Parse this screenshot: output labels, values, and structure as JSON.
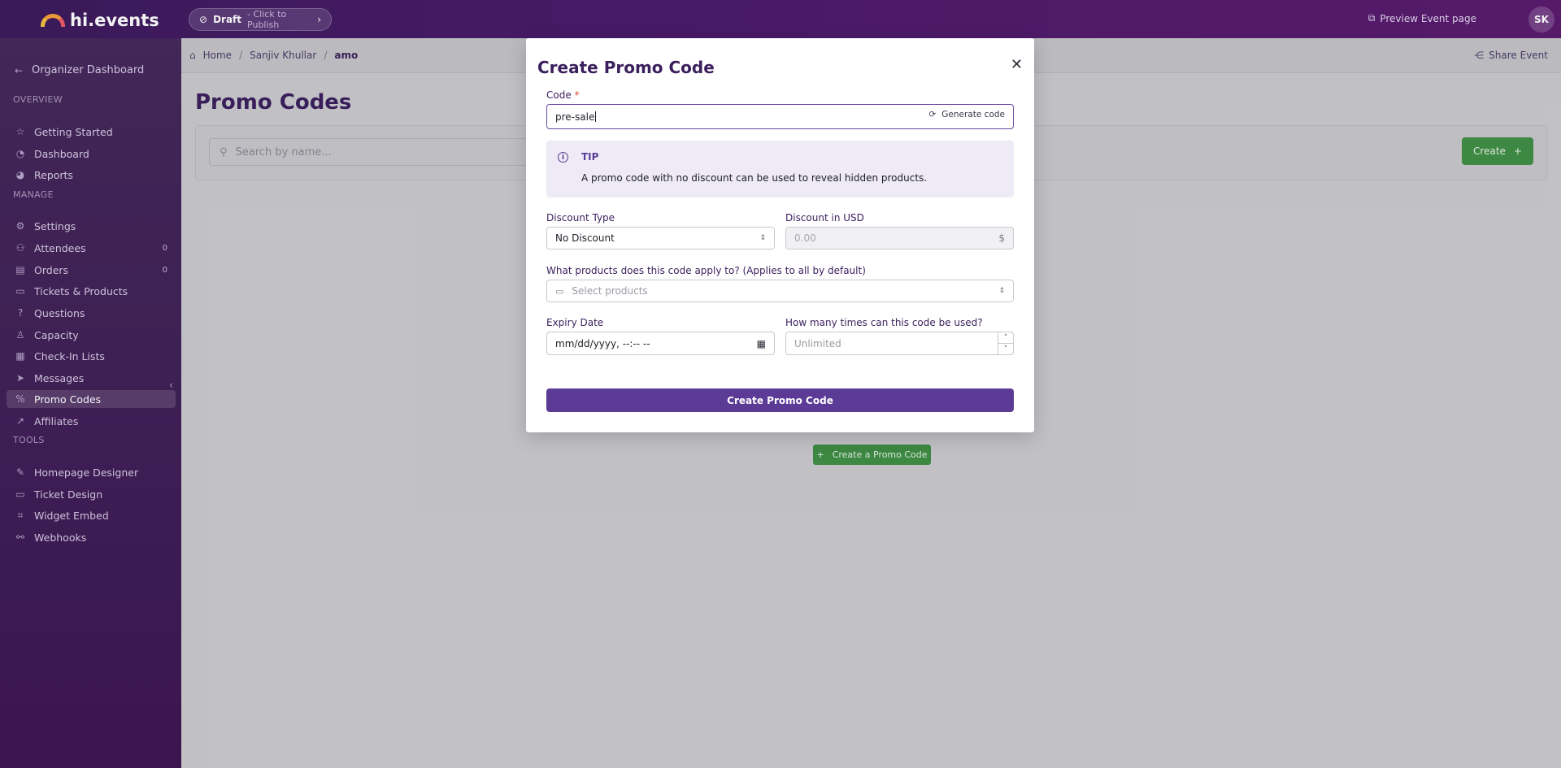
{
  "topbar": {
    "logo_text": "hi.events",
    "draft_label": "Draft",
    "draft_hint": "- Click to Publish",
    "preview_label": "Preview Event page",
    "avatar_initials": "SK"
  },
  "sidebar": {
    "back_label": "Organizer Dashboard",
    "sections": {
      "overview": "OVERVIEW",
      "manage": "MANAGE",
      "tools": "TOOLS"
    },
    "overview_items": [
      {
        "label": "Getting Started",
        "icon": "star-icon"
      },
      {
        "label": "Dashboard",
        "icon": "gauge-icon"
      },
      {
        "label": "Reports",
        "icon": "chart-pie-icon"
      }
    ],
    "manage_items": [
      {
        "label": "Settings",
        "icon": "gear-icon"
      },
      {
        "label": "Attendees",
        "icon": "users-icon",
        "count": "0"
      },
      {
        "label": "Orders",
        "icon": "receipt-icon",
        "count": "0"
      },
      {
        "label": "Tickets & Products",
        "icon": "ticket-icon"
      },
      {
        "label": "Questions",
        "icon": "question-icon"
      },
      {
        "label": "Capacity",
        "icon": "person-icon"
      },
      {
        "label": "Check-In Lists",
        "icon": "qr-icon"
      },
      {
        "label": "Messages",
        "icon": "send-icon"
      },
      {
        "label": "Promo Codes",
        "icon": "discount-icon",
        "active": true
      },
      {
        "label": "Affiliates",
        "icon": "trend-icon"
      }
    ],
    "tools_items": [
      {
        "label": "Homepage Designer",
        "icon": "brush-icon"
      },
      {
        "label": "Ticket Design",
        "icon": "ticket-icon"
      },
      {
        "label": "Widget Embed",
        "icon": "code-icon"
      },
      {
        "label": "Webhooks",
        "icon": "webhook-icon"
      }
    ]
  },
  "breadcrumb": {
    "items": [
      "Home",
      "Sanjiv Khullar",
      "amo"
    ],
    "share_label": "Share Event"
  },
  "page": {
    "title": "Promo Codes",
    "search_placeholder": "Search by name...",
    "create_label": "Create",
    "empty_create_label": "Create a Promo Code"
  },
  "modal": {
    "title": "Create Promo Code",
    "code_label": "Code",
    "code_required_mark": "*",
    "code_value": "pre-sale",
    "generate_label": "Generate code",
    "tip_title": "TIP",
    "tip_text": "A promo code with no discount can be used to reveal hidden products.",
    "discount_type_label": "Discount Type",
    "discount_type_value": "No Discount",
    "discount_amount_label": "Discount in USD",
    "discount_amount_placeholder": "0.00",
    "currency_symbol": "$",
    "products_label": "What products does this code apply to? (Applies to all by default)",
    "products_placeholder": "Select products",
    "expiry_label": "Expiry Date",
    "expiry_placeholder": "mm/dd/yyyy, --:-- --",
    "usage_label": "How many times can this code be used?",
    "usage_placeholder": "Unlimited",
    "submit_label": "Create Promo Code"
  }
}
